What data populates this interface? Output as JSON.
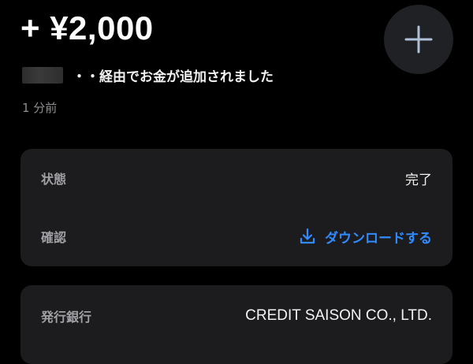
{
  "transaction": {
    "amount": "+ ¥2,000",
    "description": "・・経由でお金が追加されました",
    "time": "1 分前"
  },
  "details": {
    "status_label": "状態",
    "status_value": "完了",
    "confirm_label": "確認",
    "download_label": "ダウンロードする"
  },
  "bank": {
    "label": "発行銀行",
    "value": "CREDIT SAISON CO., LTD."
  },
  "colors": {
    "background": "#000000",
    "card": "#1c1c1e",
    "accent": "#2f8bff",
    "muted": "#8e8e93"
  },
  "icons": {
    "add": "plus-icon",
    "download": "download-icon"
  }
}
